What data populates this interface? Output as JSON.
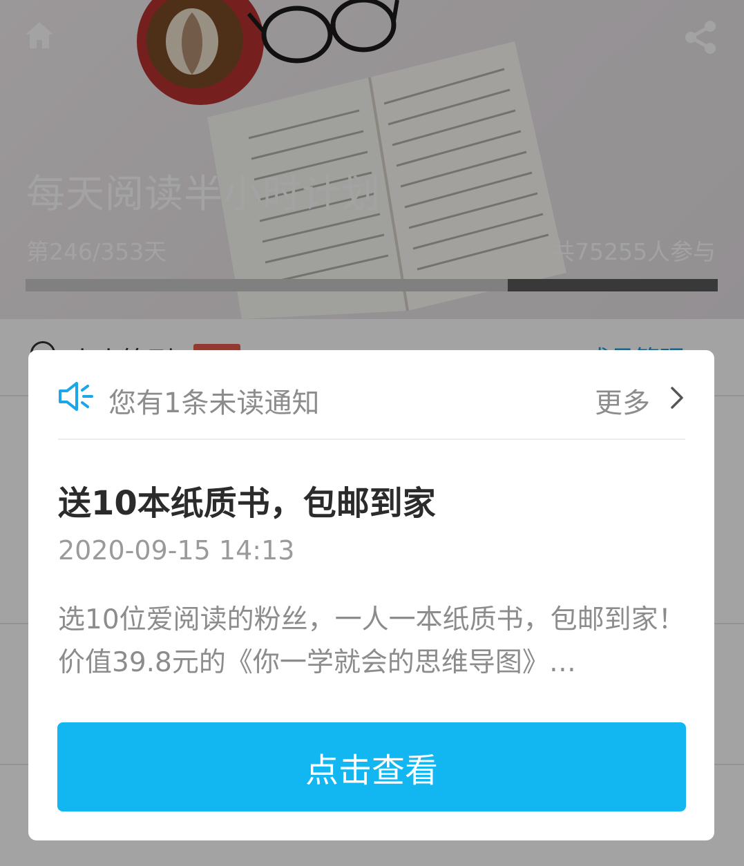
{
  "header": {
    "title": "每天阅读半小时计划",
    "day_progress": "第246/353天",
    "participants": "共75255人参与",
    "progress_fraction": 0.697
  },
  "page": {
    "checkin_label": "小小签到",
    "member_link": "成员管理 ›"
  },
  "notification": {
    "unread_text": "您有1条未读通知",
    "more_label": "更多",
    "title": "送10本纸质书，包邮到家",
    "timestamp": "2020-09-15 14:13",
    "body": "选10位爱阅读的粉丝，一人一本纸质书，包邮到家！ 价值39.8元的《你一学就会的思维导图》…",
    "button_label": "点击查看"
  },
  "icons": {
    "home": "home-icon",
    "share": "share-icon",
    "notice": "speaker-icon",
    "chevron": "chevron-right-icon"
  },
  "colors": {
    "accent": "#12b7f2",
    "notice_icon": "#1aa7e8"
  }
}
